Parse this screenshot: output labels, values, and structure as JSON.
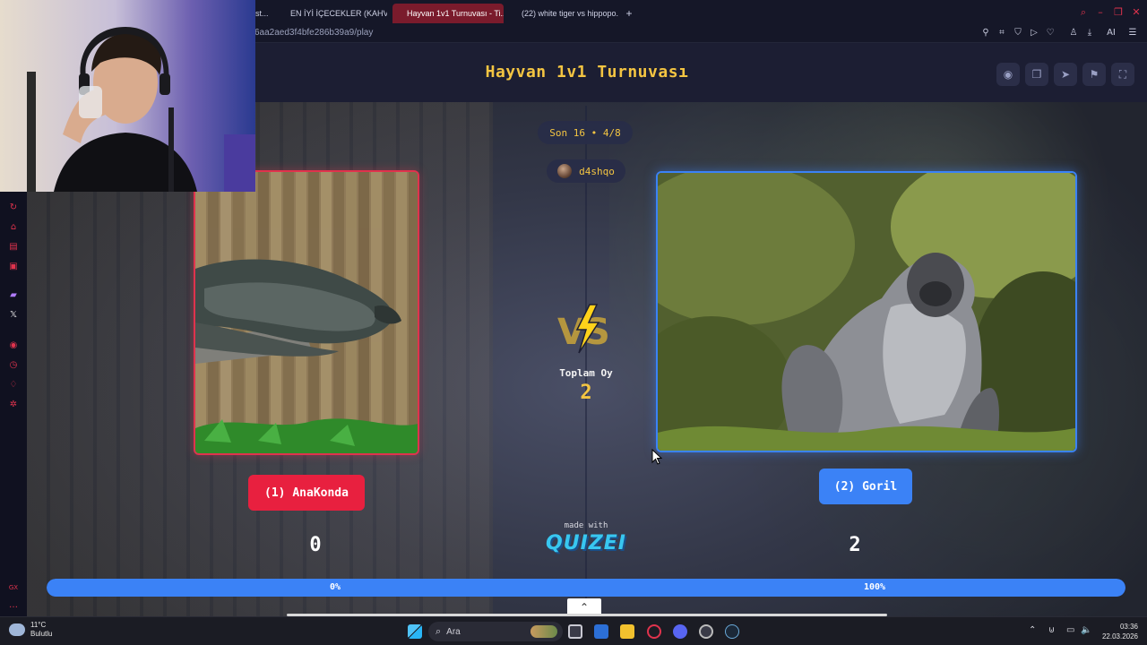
{
  "browser": {
    "tabs": [
      {
        "label": "st...",
        "favicon_color": "#e0334d",
        "active": false
      },
      {
        "label": "EN İYİ İÇECEKLER (KAHVE...",
        "favicon_color": "#4caf50",
        "active": false
      },
      {
        "label": "Hayvan 1v1 Turnuvası - Ti...",
        "favicon_color": "#f4c542",
        "active": true
      },
      {
        "label": "(22) white tiger vs hippopo...",
        "favicon_color": "#ff0000",
        "active": false
      }
    ],
    "new_tab": "+",
    "url": "6aa2aed3f4bfe286b39a9/play",
    "toolbar_icons": [
      "pin-icon",
      "crop-icon",
      "shield-icon",
      "play-icon",
      "heart-icon",
      "account-icon",
      "download-icon",
      "ai-icon",
      "menu-icon"
    ],
    "ai_label": "AI",
    "sidebar_icons": [
      "history-icon",
      "bag-icon",
      "chat-icon",
      "mail-icon",
      "twitch-icon",
      "x-icon",
      "record-icon",
      "clock-icon",
      "bulb-icon",
      "settings-icon",
      "gx-icon",
      "more-icon"
    ],
    "sidebar_gx_label": "GX"
  },
  "page": {
    "title": "Hayvan 1v1 Turnuvası",
    "header_buttons": [
      "eye-icon",
      "copy-icon",
      "send-icon",
      "flag-icon",
      "fullscreen-icon"
    ],
    "round": "Son 16 • 4/8",
    "username": "d4shqo",
    "left": {
      "name": "(1) AnaKonda",
      "score": "0",
      "percent": "0%",
      "color": "#e8203f"
    },
    "right": {
      "name": "(2) Goril",
      "score": "2",
      "percent": "100%",
      "color": "#3b82f6"
    },
    "vs_label": "VS",
    "total_label": "Toplam Oy",
    "total_value": "2",
    "made_with": "made with",
    "brand": "QUIZEI",
    "progress_right_fraction": 1.0
  },
  "taskbar": {
    "temperature": "11°C",
    "weather": "Bulutlu",
    "search_placeholder": "Ara",
    "time": "03:36",
    "date": "22.03.2026"
  },
  "colors": {
    "accent_gold": "#f4c542",
    "red": "#e8203f",
    "blue": "#3b82f6",
    "brand_cyan": "#38c7f0"
  }
}
